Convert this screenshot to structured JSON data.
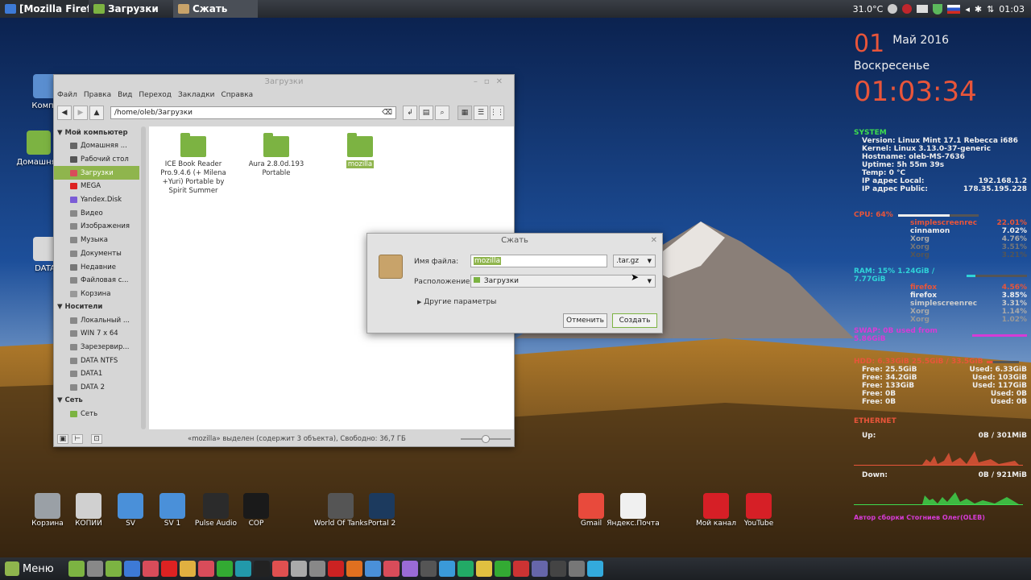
{
  "top_panel": {
    "tasks": [
      {
        "label": "[Mozilla Firef...",
        "color": "#3d7ad6"
      },
      {
        "label": "Загрузки",
        "color": "#7cb342"
      },
      {
        "label": "Сжать",
        "color": "#c8a36a"
      }
    ],
    "temperature": "31.0°C",
    "clock": "01:03"
  },
  "desktop_icons": [
    {
      "label": "Компь"
    },
    {
      "label": "Домашняя"
    },
    {
      "label": "DATA"
    }
  ],
  "conky": {
    "day": "01",
    "month_year": "Май 2016",
    "weekday": "Воскресенье",
    "time": "01:03:34",
    "system_title": "SYSTEM",
    "system": [
      {
        "k": "Version: Linux Mint 17.1 Rebecca i686",
        "v": ""
      },
      {
        "k": "Kernel: Linux 3.13.0-37-generic",
        "v": ""
      },
      {
        "k": "Hostname: oleb-MS-7636",
        "v": ""
      },
      {
        "k": "Uptime: 5h 55m 39s",
        "v": ""
      },
      {
        "k": "Temp: 0  °C",
        "v": ""
      },
      {
        "k": "IP адрес Local:",
        "v": "192.168.1.2"
      },
      {
        "k": "IP адрес Public:",
        "v": "178.35.195.228"
      }
    ],
    "cpu_title": "CPU: 64%",
    "cpu_procs": [
      {
        "k": "simplescreenrec",
        "v": "22.01%",
        "c": "#e8553a"
      },
      {
        "k": "cinnamon",
        "v": "7.02%",
        "c": "#eeeeee"
      },
      {
        "k": "Xorg",
        "v": "4.76%",
        "c": "#aaaaaa"
      },
      {
        "k": "Xorg",
        "v": "3.51%",
        "c": "#777777"
      },
      {
        "k": "Xorg",
        "v": "3.21%",
        "c": "#555555"
      }
    ],
    "ram_title": "RAM: 15% 1.24GiB / 7.77GiB",
    "ram_procs": [
      {
        "k": "firefox",
        "v": "4.56%",
        "c": "#e8553a"
      },
      {
        "k": "firefox",
        "v": "3.85%",
        "c": "#eeeeee"
      },
      {
        "k": "simplescreenrec",
        "v": "3.31%",
        "c": "#cccccc"
      },
      {
        "k": "Xorg",
        "v": "1.14%",
        "c": "#aaaaaa"
      },
      {
        "k": "Xorg",
        "v": "1.02%",
        "c": "#999999"
      }
    ],
    "swap": "SWAP: 0B    used from 5.86GiB",
    "hdd_title": "HDD: 6.33GiB 25.5GiB / 33.5GiB",
    "hdd": [
      {
        "free": "Free: 25.5GiB",
        "used": "Used: 6.33GiB"
      },
      {
        "free": "Free: 34.2GiB",
        "used": "Used: 103GiB"
      },
      {
        "free": "Free: 133GiB",
        "used": "Used: 117GiB"
      },
      {
        "free": "Free: 0B",
        "used": "Used: 0B"
      },
      {
        "free": "Free: 0B",
        "used": "Used: 0B"
      }
    ],
    "eth_title": "ETHERNET",
    "up_label": "Up:",
    "up_value": "0B    / 301MiB",
    "down_label": "Down:",
    "down_value": "0B    / 921MiB",
    "footer": "Автор сборки Стогниев Олег(OLEB)"
  },
  "file_manager": {
    "title": "Загрузки",
    "menu": [
      "Файл",
      "Правка",
      "Вид",
      "Переход",
      "Закладки",
      "Справка"
    ],
    "path": "/home/oleb/Загрузки",
    "sidebar_header_computer": "Мой компьютер",
    "computer_items": [
      {
        "label": "Домашняя ...",
        "sel": false
      },
      {
        "label": "Рабочий стол",
        "sel": false
      },
      {
        "label": "Загрузки",
        "sel": true
      },
      {
        "label": "MEGA",
        "sel": false
      },
      {
        "label": "Yandex.Disk",
        "sel": false
      },
      {
        "label": "Видео",
        "sel": false
      },
      {
        "label": "Изображения",
        "sel": false
      },
      {
        "label": "Музыка",
        "sel": false
      },
      {
        "label": "Документы",
        "sel": false
      },
      {
        "label": "Недавние",
        "sel": false
      },
      {
        "label": "Файловая с...",
        "sel": false
      },
      {
        "label": "Корзина",
        "sel": false
      }
    ],
    "sidebar_header_devices": "Носители",
    "device_items": [
      {
        "label": "Локальный ..."
      },
      {
        "label": "WIN 7 x 64"
      },
      {
        "label": "Зарезервир..."
      },
      {
        "label": "DATA NTFS"
      },
      {
        "label": "DATA1"
      },
      {
        "label": "DATA 2"
      }
    ],
    "sidebar_header_network": "Сеть",
    "network_items": [
      {
        "label": "Сеть"
      }
    ],
    "files": [
      {
        "name": "ICE Book Reader Pro.9.4.6  (+ Milena +Yuri) Portable by Spirit Summer",
        "selected": false
      },
      {
        "name": "Aura 2.8.0d.193 Portable",
        "selected": false
      },
      {
        "name": "mozilla",
        "selected": true
      }
    ],
    "status": "«mozilla» выделен (содержит 3 объекта), Свободно: 36,7 ГБ"
  },
  "dialog": {
    "title": "Сжать",
    "filename_label": "Имя файла:",
    "filename_value": "mozilla",
    "extension": ".tar.gz",
    "location_label": "Расположение:",
    "location_value": "Загрузки",
    "more_options": "Другие параметры",
    "cancel": "Отменить",
    "create": "Создать"
  },
  "dock": [
    {
      "label": "Корзина",
      "color": "#9aa0a6"
    },
    {
      "label": "КОПИИ",
      "color": "#d0d0d0"
    },
    {
      "label": "SV",
      "color": "#4a90d9"
    },
    {
      "label": "SV 1",
      "color": "#4a90d9"
    },
    {
      "label": "Pulse Audio",
      "color": "#2b2b2b"
    },
    {
      "label": "COP",
      "color": "#1a1a1a"
    },
    {
      "label": "World Of Tanks",
      "color": "#555555"
    },
    {
      "label": "Portal 2",
      "color": "#1c3a5e"
    },
    {
      "label": "Gmail",
      "color": "#e84a3c"
    },
    {
      "label": "Яндекс.Почта",
      "color": "#f0f0f0"
    },
    {
      "label": "Мой канал",
      "color": "#d61f26"
    },
    {
      "label": "YouTube",
      "color": "#d61f26"
    }
  ],
  "bottom_panel": {
    "menu_label": "Меню"
  }
}
